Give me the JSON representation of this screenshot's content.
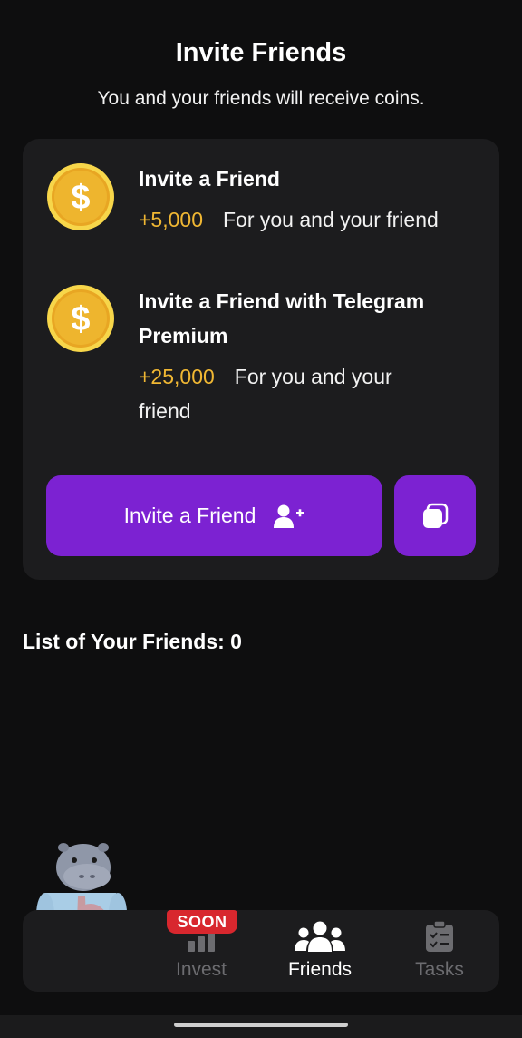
{
  "header": {
    "title": "Invite Friends",
    "subtitle": "You and your friends will receive coins."
  },
  "offers": [
    {
      "icon": "dollar-coin-icon",
      "title": "Invite a Friend",
      "amount": "+5,000",
      "description": "For you and your friend"
    },
    {
      "icon": "dollar-coin-icon",
      "title_line1": "Invite a Friend with Telegram",
      "title_line2": "Premium",
      "amount": "+25,000",
      "description_line1": "For you and your",
      "description_line2": "friend"
    }
  ],
  "actions": {
    "invite_label": "Invite a Friend",
    "invite_icon": "add-user-icon",
    "copy_icon": "copy-icon"
  },
  "friends": {
    "list_label": "List of Your Friends: 0"
  },
  "nav": {
    "items": [
      {
        "label": "Invest",
        "icon": "bar-chart-icon",
        "badge": "SOON",
        "active": false
      },
      {
        "label": "Friends",
        "icon": "users-icon",
        "active": true
      },
      {
        "label": "Tasks",
        "icon": "checklist-icon",
        "active": false
      }
    ]
  },
  "colors": {
    "background": "#0e0e0f",
    "card": "#1c1c1e",
    "accent": "#7c22d2",
    "coin_amount": "#f0b733",
    "badge": "#d8272e"
  }
}
